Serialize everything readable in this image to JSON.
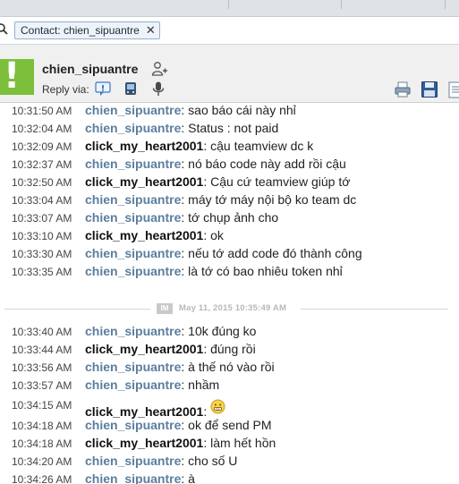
{
  "filter": {
    "chip_label": "Contact: chien_sipuantre",
    "close_glyph": "✕",
    "icon": "search-icon"
  },
  "header": {
    "contact_name": "chien_sipuantre",
    "reply_via_label": "Reply via:",
    "icons": [
      "add-contact-icon",
      "im-icon",
      "sms-icon",
      "voice-icon",
      "print-icon",
      "save-icon",
      "document-icon"
    ]
  },
  "chat": {
    "block1": [
      {
        "time": "10:31:50 AM",
        "sender": "chien_sipuantre",
        "text": ": sao báo cái này nhỉ",
        "from": "them"
      },
      {
        "time": "10:32:04 AM",
        "sender": "chien_sipuantre",
        "text": ": Status : not paid",
        "from": "them"
      },
      {
        "time": "10:32:09 AM",
        "sender": "click_my_heart2001",
        "text": ": cậu teamview dc k",
        "from": "me"
      },
      {
        "time": "10:32:37 AM",
        "sender": "chien_sipuantre",
        "text": ": nó báo code này add rồi cậu",
        "from": "them"
      },
      {
        "time": "10:32:50 AM",
        "sender": "click_my_heart2001",
        "text": ": Cậu cứ teamview giúp tớ",
        "from": "me"
      },
      {
        "time": "10:33:04 AM",
        "sender": "chien_sipuantre",
        "text": ": máy tớ máy nội bộ ko team dc",
        "from": "them"
      },
      {
        "time": "10:33:07 AM",
        "sender": "chien_sipuantre",
        "text": ": tớ chụp ảnh cho",
        "from": "them"
      },
      {
        "time": "10:33:10 AM",
        "sender": "click_my_heart2001",
        "text": ": ok",
        "from": "me"
      },
      {
        "time": "10:33:30 AM",
        "sender": "chien_sipuantre",
        "text": ": nếu tớ add code đó thành công",
        "from": "them"
      },
      {
        "time": "10:33:35 AM",
        "sender": "chien_sipuantre",
        "text": ": là tớ có bao nhiêu token nhỉ",
        "from": "them"
      }
    ],
    "separator": {
      "badge": "IM",
      "date": "May 11, 2015 10:35:49 AM"
    },
    "block2": [
      {
        "time": "10:33:40 AM",
        "sender": "chien_sipuantre",
        "text": ": 10k đúng ko",
        "from": "them"
      },
      {
        "time": "10:33:44 AM",
        "sender": "click_my_heart2001",
        "text": ": đúng rồi",
        "from": "me"
      },
      {
        "time": "10:33:56 AM",
        "sender": "chien_sipuantre",
        "text": ": à thế nó vào rồi",
        "from": "them"
      },
      {
        "time": "10:33:57 AM",
        "sender": "chien_sipuantre",
        "text": ": nhầm",
        "from": "them"
      },
      {
        "time": "10:34:15 AM",
        "sender": "click_my_heart2001",
        "text": ": ",
        "from": "me",
        "emoticon": "grimace-emoticon"
      },
      {
        "time": "10:34:18 AM",
        "sender": "chien_sipuantre",
        "text": ": ok để send PM",
        "from": "them"
      },
      {
        "time": "10:34:18 AM",
        "sender": "click_my_heart2001",
        "text": ": làm hết hồn",
        "from": "me"
      },
      {
        "time": "10:34:20 AM",
        "sender": "chien_sipuantre",
        "text": ": cho số U",
        "from": "them"
      },
      {
        "time": "10:34:26 AM",
        "sender": "chien_sipuantre",
        "text": ": à",
        "from": "them"
      }
    ]
  },
  "colors": {
    "them": "#5b7e9e",
    "me": "#111111",
    "logo": "#7bbf3a"
  }
}
